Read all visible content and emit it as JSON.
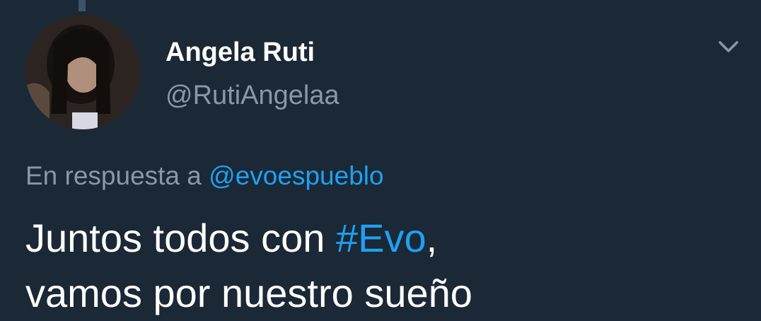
{
  "tweet": {
    "author": {
      "display_name": "Angela Ruti",
      "handle": "@RutiAngelaa",
      "avatar_icon": "profile-photo"
    },
    "menu_icon": "chevron-down-icon",
    "reply_context": {
      "prefix": "En respuesta a ",
      "mention": "@evoespueblo"
    },
    "text": {
      "line1_before": "Juntos todos con ",
      "hashtag": "#Evo",
      "line1_after": ",",
      "line2": "vamos por nuestro sueño"
    }
  },
  "colors": {
    "background": "#1b2836",
    "primary_text": "#ffffff",
    "secondary_text": "#8899a6",
    "link": "#1da1f2"
  }
}
